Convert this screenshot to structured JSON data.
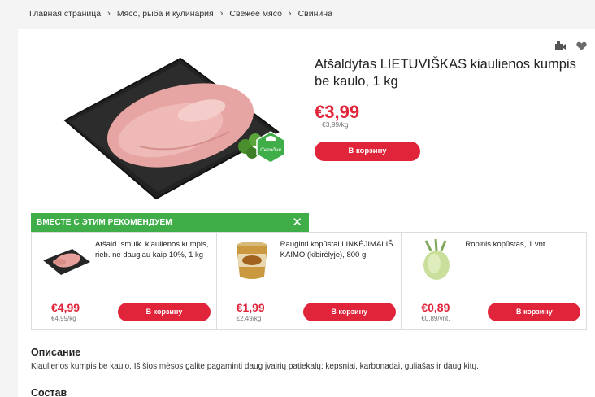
{
  "breadcrumb": [
    "Главная страница",
    "Мясо, рыба и кулинария",
    "Свежее мясо",
    "Свинина"
  ],
  "product": {
    "title": "Atšaldytas LIETUVIŠKAS kiaulienos kumpis be kaulo, 1 kg",
    "price": "€3,99",
    "unit_price": "€3,99/kg",
    "cart_label": "В корзину",
    "badge_label": "Сегодня"
  },
  "recommend": {
    "title": "ВМЕСТЕ С ЭТИМ РЕКОМЕНДУЕМ",
    "items": [
      {
        "name": "Atšald. smulk. kiaulienos kumpis, rieb. ne daugiau kaip 10%, 1 kg",
        "price": "€4,99",
        "unit": "€4,99/kg",
        "cart_label": "В корзину"
      },
      {
        "name": "Rauginti kopūstai LINKĖJIMAI IŠ KAIMO (kibirėlyje), 800 g",
        "price": "€1,99",
        "unit": "€2,49/kg",
        "cart_label": "В корзину"
      },
      {
        "name": "Ropinis kopūstas, 1 vnt.",
        "price": "€0,89",
        "unit": "€0,89/vnt.",
        "cart_label": "В корзину"
      }
    ]
  },
  "description": {
    "title": "Описание",
    "text": "Kiaulienos kumpis be kaulo. Iš šios mėsos galite pagaminti daug įvairių patiekalų: kepsniai, karbonadai, guliašas ir daug kitų."
  },
  "composition": {
    "title": "Состав"
  },
  "colors": {
    "accent": "#e0243a",
    "green": "#3fae49"
  }
}
